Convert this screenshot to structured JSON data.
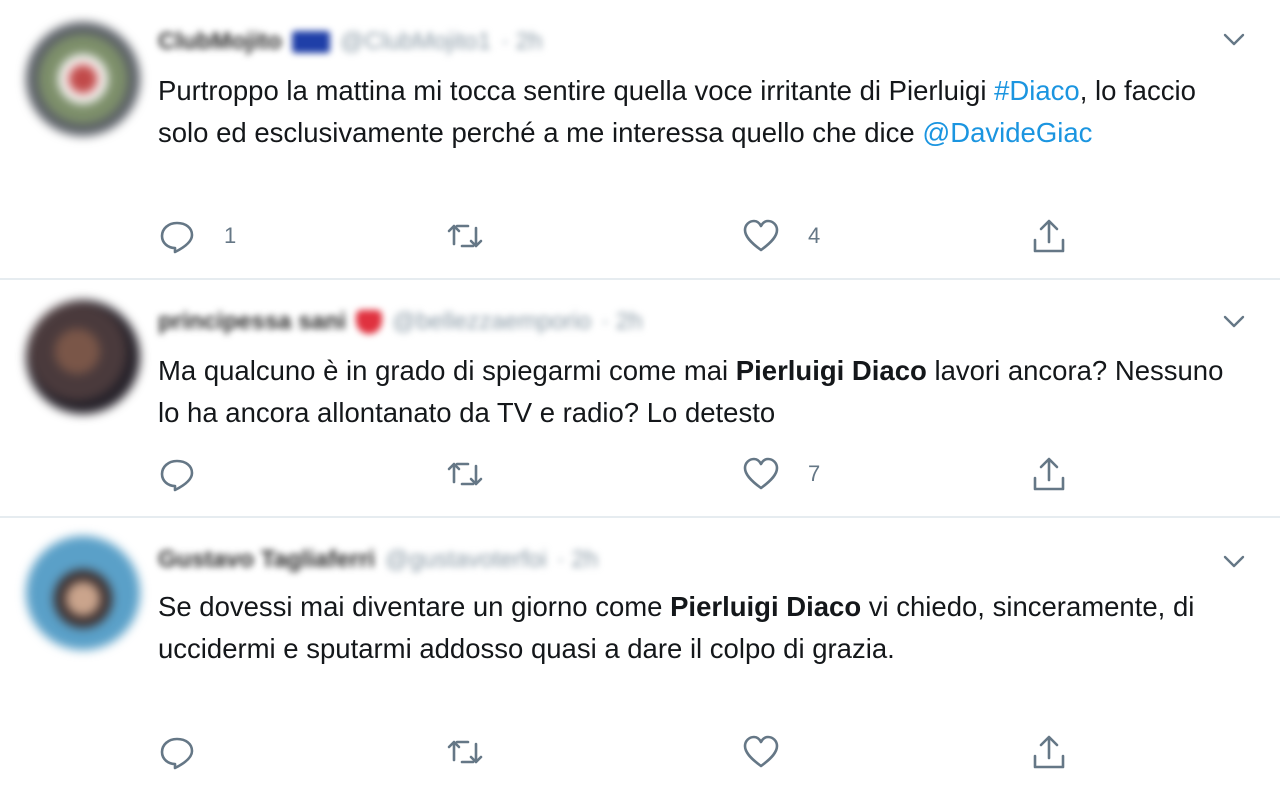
{
  "tweets": [
    {
      "author_name": "ClubMojito",
      "author_handle": "@ClubMojito1",
      "time": "· 2h",
      "emoji": "flag",
      "text_parts": [
        "Purtroppo la mattina mi tocca sentire quella voce irritante di Pierluigi ",
        "#Diaco",
        ", lo faccio solo ed esclusivamente perché a me interessa quello che dice ",
        "@DavideGiac"
      ],
      "replies": "1",
      "retweets": "",
      "likes": "4"
    },
    {
      "author_name": "principessa sani",
      "author_handle": "@bellezzaemporio",
      "time": "· 2h",
      "emoji": "heart",
      "text_parts": [
        "Ma qualcuno è in grado di spiegarmi come mai ",
        "Pierluigi Diaco",
        " lavori ancora? Nessuno lo ha ancora allontanato da TV e radio? Lo detesto"
      ],
      "replies": "",
      "retweets": "",
      "likes": "7"
    },
    {
      "author_name": "Gustavo Tagliaferri",
      "author_handle": "@gustavoterfoi",
      "time": "· 2h",
      "emoji": "",
      "text_parts": [
        "Se dovessi mai diventare un giorno come ",
        "Pierluigi Diaco",
        " vi chiedo, sinceramente, di uccidermi e sputarmi addosso quasi a dare il colpo di grazia."
      ],
      "replies": "",
      "retweets": "",
      "likes": ""
    }
  ],
  "icons": {
    "reply": "reply-icon",
    "retweet": "retweet-icon",
    "like": "heart-icon",
    "share": "share-icon",
    "menu": "chevron-down-icon"
  },
  "colors": {
    "link": "#1b95e0",
    "icon": "#657786",
    "divider": "#e6ecf0"
  }
}
